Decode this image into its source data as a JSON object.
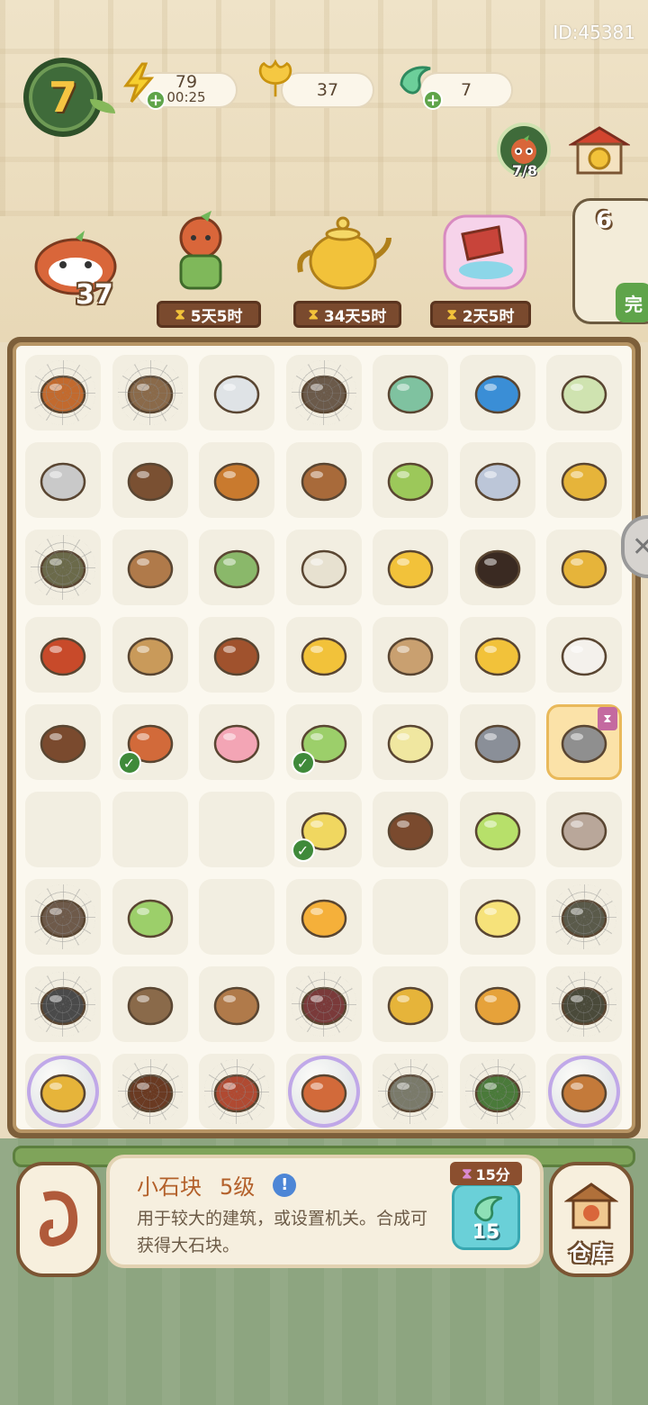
{
  "header": {
    "player_id": "ID:45381",
    "level": "7",
    "energy": {
      "value": "79",
      "timer": "00:25"
    },
    "ginkgo": {
      "value": "37"
    },
    "gem": {
      "value": "7"
    },
    "visitors": "7/8"
  },
  "orders": {
    "left_count": "37",
    "items": [
      {
        "timer": "5天5时"
      },
      {
        "timer": "34天5时"
      },
      {
        "timer": "2天5时"
      }
    ],
    "right_count": "6",
    "right_button": "完"
  },
  "board": {
    "rows": [
      [
        {
          "icon": "campfire-icon",
          "web": true,
          "color": "#c26a2e"
        },
        {
          "icon": "basket-icon",
          "web": true,
          "color": "#8a6a4a"
        },
        {
          "icon": "spoon-icon",
          "color": "#dfe3e6"
        },
        {
          "icon": "tea-branch-icon",
          "web": true,
          "color": "#6b5a4a"
        },
        {
          "icon": "water-drop-icon",
          "color": "#7fc2a0"
        },
        {
          "icon": "energy-card-icon",
          "color": "#3a8ed6"
        },
        {
          "icon": "tea-cake-icon",
          "color": "#cfe3b0"
        }
      ],
      [
        {
          "icon": "bells-icon",
          "color": "#c9c9c9"
        },
        {
          "icon": "tea-seeds-icon",
          "color": "#7a5032"
        },
        {
          "icon": "candle-icon",
          "color": "#c97a2e"
        },
        {
          "icon": "soil-box-icon",
          "color": "#a86a3a"
        },
        {
          "icon": "herb-tray-icon",
          "color": "#9cc85a"
        },
        {
          "icon": "hourglass-icon",
          "color": "#bcc6d8"
        },
        {
          "icon": "golden-bowl-icon",
          "color": "#e6b43a"
        }
      ],
      [
        {
          "icon": "mortar-icon",
          "web": true,
          "color": "#6b6a4a"
        },
        {
          "icon": "picnic-basket-icon",
          "color": "#b07a4a"
        },
        {
          "icon": "sprout-icon",
          "color": "#8ab86a"
        },
        {
          "icon": "teacup-lid-icon",
          "color": "#e7e1d0"
        },
        {
          "icon": "ginkgo-leaf-icon",
          "color": "#f2c23a"
        },
        {
          "icon": "scroll-dark-icon",
          "color": "#3a2a22"
        },
        {
          "icon": "lemon-bowl-icon",
          "color": "#e6b43a"
        }
      ],
      [
        {
          "icon": "scroll-red-icon",
          "color": "#c84a2a"
        },
        {
          "icon": "rope-ball-icon",
          "color": "#c99a5a"
        },
        {
          "icon": "cinnamon-icon",
          "color": "#a0522d"
        },
        {
          "icon": "ginkgo-bunch-icon",
          "color": "#f2c23a"
        },
        {
          "icon": "woven-straw-icon",
          "color": "#c9a070"
        },
        {
          "icon": "ginkgo-pile-icon",
          "color": "#f2c23a"
        },
        {
          "icon": "sheep-icon",
          "color": "#f4f1ec"
        }
      ],
      [
        {
          "icon": "dried-flower-icon",
          "color": "#7a4a2e"
        },
        {
          "icon": "tea-set-icon",
          "check": true,
          "color": "#d26a3a"
        },
        {
          "icon": "butterfly-icon",
          "color": "#f3a5b5"
        },
        {
          "icon": "bamboo-roll-icon",
          "check": true,
          "color": "#9ccf6a"
        },
        {
          "icon": "soup-bowl-icon",
          "color": "#f0e7a0"
        },
        {
          "icon": "incense-icon",
          "color": "#8a8f98"
        },
        {
          "icon": "stone-icon",
          "highlight": true,
          "timer": true,
          "color": "#8f8f8f"
        }
      ],
      [
        {
          "icon": "empty",
          "color": ""
        },
        {
          "icon": "empty",
          "color": ""
        },
        {
          "icon": "empty",
          "color": ""
        },
        {
          "icon": "ginkgo-tea-icon",
          "check": true,
          "color": "#f0d760"
        },
        {
          "icon": "tea-leaves-icon",
          "color": "#7a4a2e"
        },
        {
          "icon": "bamboo-cup-icon",
          "color": "#b7e06a"
        },
        {
          "icon": "incense-burner-icon",
          "color": "#b9a79a"
        }
      ],
      [
        {
          "icon": "log-icon",
          "web": true,
          "color": "#6e5a4a"
        },
        {
          "icon": "bamboo-shoot-icon",
          "color": "#9ccf6a"
        },
        {
          "icon": "empty",
          "color": ""
        },
        {
          "icon": "gourd-flame-icon",
          "color": "#f5b03a"
        },
        {
          "icon": "empty",
          "color": ""
        },
        {
          "icon": "teapot-glow-icon",
          "color": "#f6e27a"
        },
        {
          "icon": "rock-pile-icon",
          "web": true,
          "color": "#5a5a4a"
        }
      ],
      [
        {
          "icon": "brush-icon",
          "web": true,
          "color": "#4a4a4a"
        },
        {
          "icon": "seed-jar-icon",
          "color": "#8a6a4a"
        },
        {
          "icon": "wood-plank-icon",
          "color": "#b07a4a"
        },
        {
          "icon": "leaf-bundle-icon",
          "web": true,
          "color": "#7a3a3a"
        },
        {
          "icon": "golden-cup-icon",
          "color": "#e6b43a"
        },
        {
          "icon": "lantern-box-icon",
          "color": "#e6a23a"
        },
        {
          "icon": "ore-block-icon",
          "web": true,
          "color": "#4a4a3a"
        }
      ],
      [
        {
          "icon": "frog-bubble-icon",
          "bubble": true,
          "color": "#e6b43a"
        },
        {
          "icon": "seed-pod-icon",
          "web": true,
          "color": "#6a3a22"
        },
        {
          "icon": "berry-icon",
          "web": true,
          "color": "#b04a32"
        },
        {
          "icon": "meal-bubble-icon",
          "bubble": true,
          "color": "#d26a3a"
        },
        {
          "icon": "stone-bowl-icon",
          "web": true,
          "color": "#7a7a6a"
        },
        {
          "icon": "herb-sprig-icon",
          "web": true,
          "color": "#4a7a3a"
        },
        {
          "icon": "chest-bubble-icon",
          "bubble": true,
          "color": "#c47a3a"
        }
      ]
    ]
  },
  "info": {
    "name": "小石块",
    "level": "5级",
    "description": "用于较大的建筑，或设置机关。合成可获得大石块。",
    "speedup_timer": "15分",
    "speedup_cost": "15"
  },
  "warehouse": {
    "label": "仓库"
  },
  "colors": {
    "board_frame": "#7d5f3a",
    "level_badge": "#3f6b3a",
    "accent_green": "#5fa44a",
    "ginkgo_gold": "#f2c23a"
  }
}
